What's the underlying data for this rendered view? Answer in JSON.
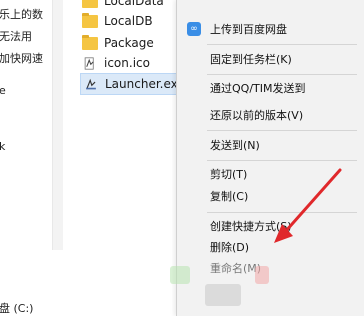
{
  "nav_pane": {
    "items": [
      {
        "label": "乐上的数"
      },
      {
        "label": "无法用"
      },
      {
        "label": "加快网速"
      },
      {
        "label": "e"
      },
      {
        "label": "k"
      },
      {
        "label": "盘 (C:)"
      }
    ]
  },
  "file_list": {
    "items": [
      {
        "name": "LocalData",
        "icon": "folder-icon"
      },
      {
        "name": "LocalDB",
        "icon": "folder-icon"
      },
      {
        "name": "Package",
        "icon": "folder-icon"
      },
      {
        "name": "icon.ico",
        "icon": "ico-file-icon"
      },
      {
        "name": "Launcher.exe",
        "icon": "exe-file-icon"
      }
    ]
  },
  "context_menu": {
    "items": [
      {
        "label": "上传到百度网盘",
        "icon": "baidu-netdisk-icon"
      },
      {
        "label": "固定到任务栏(K)"
      },
      {
        "label": "通过QQ/TIM发送到"
      },
      {
        "label": "还原以前的版本(V)"
      },
      {
        "label": "发送到(N)"
      },
      {
        "label": "剪切(T)"
      },
      {
        "label": "复制(C)"
      },
      {
        "label": "创建快捷方式(S)"
      },
      {
        "label": "删除(D)"
      },
      {
        "label": "重命名(M)"
      }
    ]
  },
  "colors": {
    "menu_background": "#f2f2f2",
    "selection": "#dbe9f8",
    "annotation_arrow": "#e0282b"
  }
}
